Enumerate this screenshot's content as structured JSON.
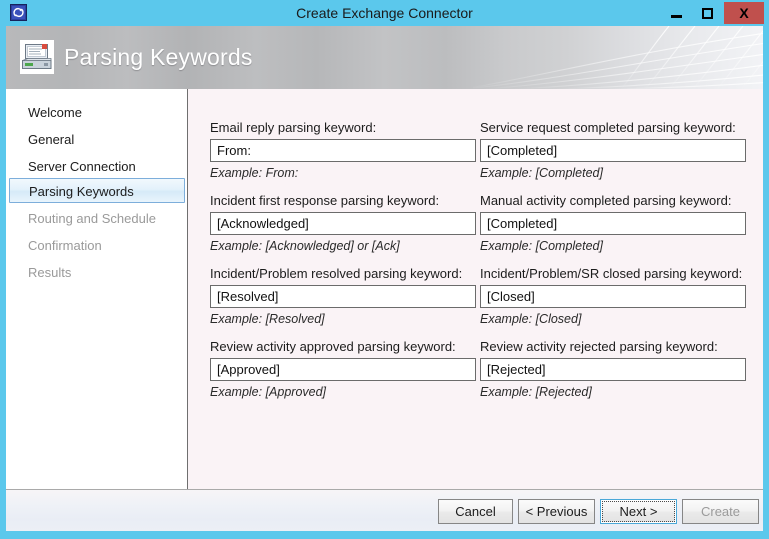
{
  "window": {
    "title": "Create Exchange Connector",
    "icon": "exchange-connector-icon",
    "controls": {
      "minimize": "minimize-icon",
      "maximize": "maximize-icon",
      "close_label": "X"
    },
    "frame_color": "#5bc8ec"
  },
  "banner": {
    "title": "Parsing Keywords",
    "icon": "server-connector-icon"
  },
  "sidebar": {
    "items": [
      {
        "label": "Welcome",
        "state": "enabled"
      },
      {
        "label": "General",
        "state": "enabled"
      },
      {
        "label": "Server Connection",
        "state": "enabled"
      },
      {
        "label": "Parsing Keywords",
        "state": "selected"
      },
      {
        "label": "Routing and Schedule",
        "state": "disabled"
      },
      {
        "label": "Confirmation",
        "state": "disabled"
      },
      {
        "label": "Results",
        "state": "disabled"
      }
    ],
    "selected_index": 3
  },
  "content": {
    "fields": [
      {
        "label": "Email reply parsing keyword:",
        "value": "From:",
        "placeholder": "",
        "example": "Example: From:"
      },
      {
        "label": "Service request completed parsing keyword:",
        "value": "[Completed]",
        "placeholder": "",
        "example": "Example: [Completed]"
      },
      {
        "label": "Incident first response parsing keyword:",
        "value": "[Acknowledged]",
        "placeholder": "",
        "example": "Example: [Acknowledged] or [Ack]"
      },
      {
        "label": "Manual activity completed parsing keyword:",
        "value": "[Completed]",
        "placeholder": "",
        "example": "Example: [Completed]"
      },
      {
        "label": "Incident/Problem resolved parsing keyword:",
        "value": "[Resolved]",
        "placeholder": "",
        "example": "Example: [Resolved]"
      },
      {
        "label": "Incident/Problem/SR closed parsing keyword:",
        "value": "[Closed]",
        "placeholder": "",
        "example": "Example: [Closed]"
      },
      {
        "label": "Review activity approved parsing keyword:",
        "value": "[Approved]",
        "placeholder": "",
        "example": "Example: [Approved]"
      },
      {
        "label": "Review activity rejected parsing keyword:",
        "value": "[Rejected]",
        "placeholder": "",
        "example": "Example: [Rejected]"
      }
    ]
  },
  "footer": {
    "buttons": [
      {
        "label": "Cancel",
        "state": "enabled"
      },
      {
        "label": "< Previous",
        "state": "enabled"
      },
      {
        "label": "Next >",
        "state": "focused"
      },
      {
        "label": "Create",
        "state": "disabled"
      }
    ]
  }
}
